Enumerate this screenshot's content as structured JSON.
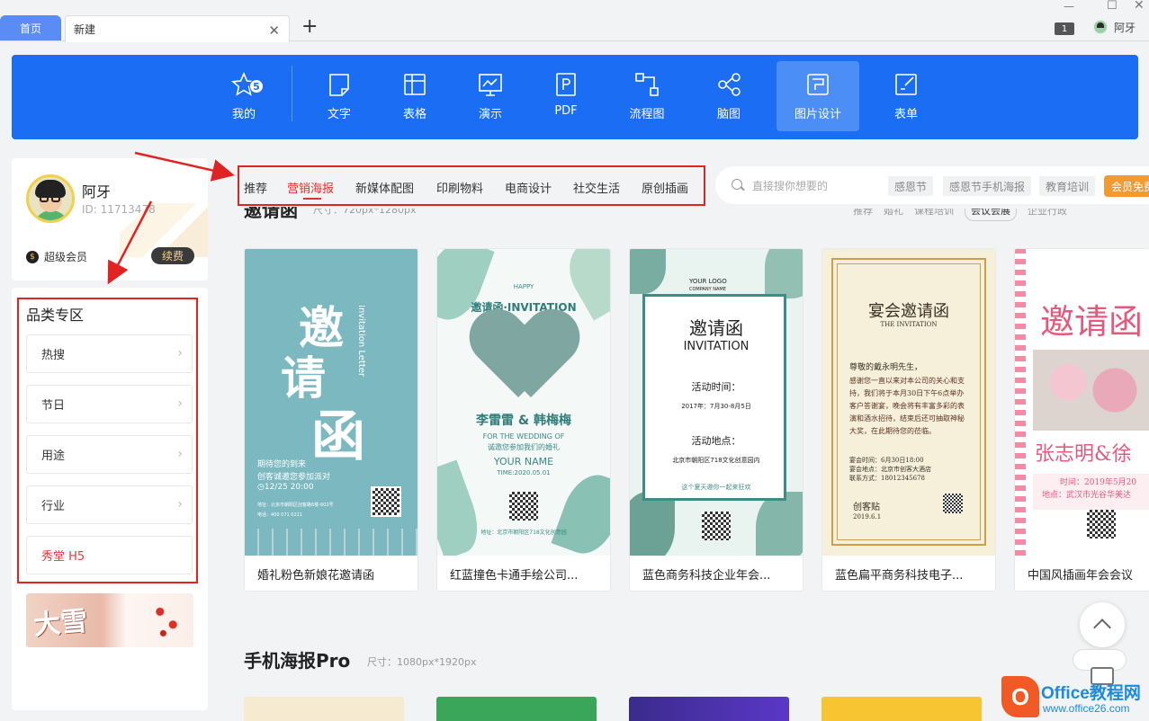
{
  "tabs": {
    "home": "首页",
    "new": "新建"
  },
  "window": {
    "page_count": "1",
    "user": "阿牙"
  },
  "toolbar": {
    "mine_badge": "5",
    "items": [
      {
        "label": "我的",
        "icon": "star-icon"
      },
      {
        "label": "文字",
        "icon": "doc-icon"
      },
      {
        "label": "表格",
        "icon": "table-icon"
      },
      {
        "label": "演示",
        "icon": "presentation-icon"
      },
      {
        "label": "PDF",
        "icon": "pdf-icon"
      },
      {
        "label": "流程图",
        "icon": "flowchart-icon"
      },
      {
        "label": "脑图",
        "icon": "mindmap-icon"
      },
      {
        "label": "图片设计",
        "icon": "image-design-icon"
      },
      {
        "label": "表单",
        "icon": "form-icon"
      }
    ],
    "active": "图片设计"
  },
  "profile": {
    "name": "阿牙",
    "id": "ID: 11713478",
    "vip": "超级会员",
    "renew": "续费"
  },
  "categories": {
    "title": "品类专区",
    "items": [
      "热搜",
      "节日",
      "用途",
      "行业",
      "秀堂 H5"
    ],
    "banner": "大雪"
  },
  "nav": {
    "items": [
      "推荐",
      "营销海报",
      "新媒体配图",
      "印刷物料",
      "电商设计",
      "社交生活",
      "原创插画"
    ],
    "active": "营销海报"
  },
  "search": {
    "placeholder": "直接搜你想要的",
    "tags": [
      "感恩节",
      "感恩节手机海报",
      "教育培训"
    ],
    "vip_free": "会员免费"
  },
  "section1": {
    "title": "邀请函",
    "size": "尺寸：720px*1280px",
    "filters": [
      "推荐",
      "婚礼",
      "课程培训",
      "会议会展",
      "企业行政"
    ],
    "selected_filter": "会议会展"
  },
  "cards": [
    {
      "caption": "婚礼粉色新娘花邀请函",
      "lines": [
        "邀",
        "请",
        "函",
        "Invitation Letter",
        "期待您的到来",
        "创客诚邀您参加派对",
        "◷12/25  20:00",
        "地址：北京市朝阳区创客路6楼-602号",
        "电话：400 071 0211"
      ]
    },
    {
      "caption": "红蓝撞色卡通手绘公司...",
      "lines": [
        "HAPPY",
        "邀请函·INVITATION",
        "李雷雷 & 韩梅梅",
        "FOR THE WEDDING OF",
        "诚邀您参加我们的婚礼",
        "YOUR NAME",
        "TIME:2020.05.01",
        "地址：北京市朝阳区718文化创意园"
      ]
    },
    {
      "caption": "蓝色商务科技企业年会...",
      "lines": [
        "YOUR LOGO",
        "COMPANY NAME",
        "邀请函",
        "INVITATION",
        "活动时间：",
        "2017年：7月30-8月5日",
        "活动地点：",
        "北京市朝阳区718文化创意园内",
        "这个夏天邀你一起来狂欢"
      ]
    },
    {
      "caption": "蓝色扁平商务科技电子...",
      "lines": [
        "宴会邀请函",
        "THE INVITATION",
        "尊敬的戴永明先生，",
        "感谢您一直以来对本公司的关心和支持，我们将于本月30日下午6点举办客户答谢宴，晚会将有丰富多彩的表演和酒水招待，结束后还可抽取神秘大奖，在此期待您的莅临。",
        "宴会时间：6月30日18:00",
        "宴会地点：北京市创客大酒店",
        "联系方式：18012345678",
        "创客贴",
        "2019.6.1"
      ]
    },
    {
      "caption": "中国风插画年会会议",
      "lines": [
        "邀请函",
        "张志明&徐",
        "时间：2019年5月20",
        "地点：武汉市光谷华美达"
      ]
    }
  ],
  "section2": {
    "title": "手机海报Pro",
    "size": "尺寸：1080px*1920px"
  },
  "watermark": {
    "brand": "Office教程网",
    "url": "www.office26.com"
  },
  "colors": {
    "toolbar": "#1b6ef3",
    "accent_red": "#e0322d",
    "annotation": "#e02424",
    "vip_orange": "#f39a33"
  }
}
